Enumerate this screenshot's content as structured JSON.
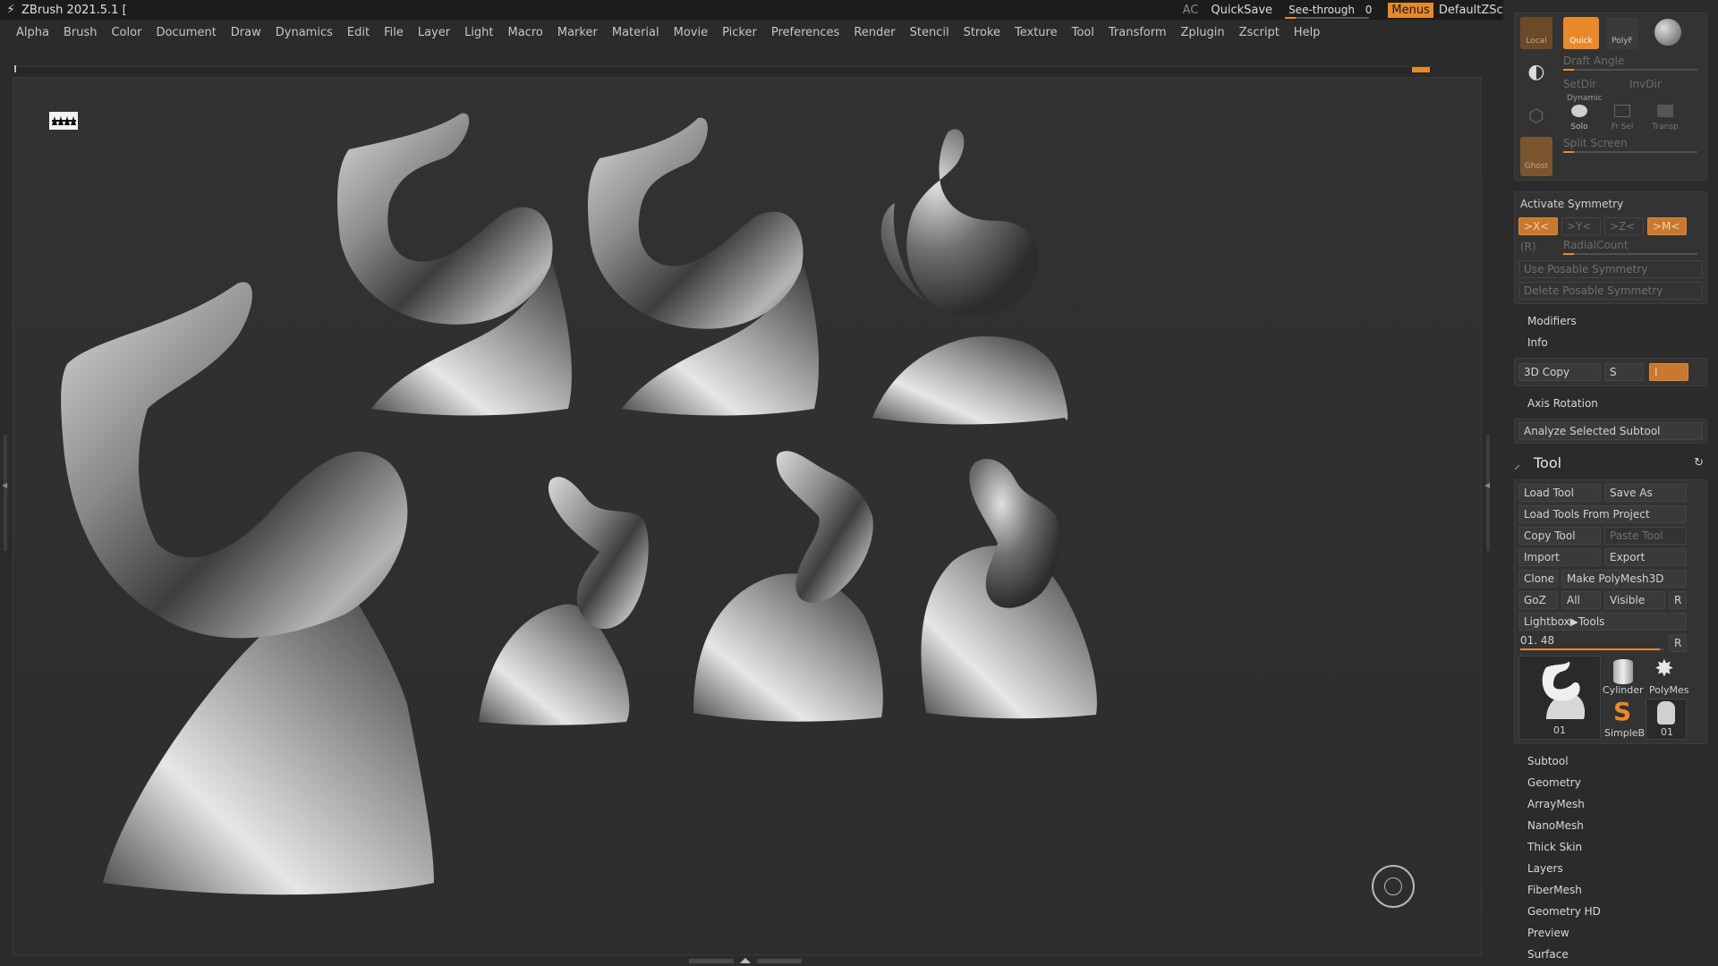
{
  "titlebar": {
    "title": "ZBrush 2021.5.1 [",
    "ac": "AC",
    "quicksave": "QuickSave",
    "see_through_label": "See-through",
    "see_through_value": "0",
    "see_through_level": 0,
    "menus": "Menus",
    "script": "DefaultZScript"
  },
  "menubar": {
    "items": [
      "Alpha",
      "Brush",
      "Color",
      "Document",
      "Draw",
      "Dynamics",
      "Edit",
      "File",
      "Layer",
      "Light",
      "Macro",
      "Marker",
      "Material",
      "Movie",
      "Picker",
      "Preferences",
      "Render",
      "Stencil",
      "Stroke",
      "Texture",
      "Tool",
      "Transform",
      "Zplugin",
      "Zscript",
      "Help"
    ]
  },
  "rpanel": {
    "top": {
      "local": "Local",
      "quick": "Quick",
      "polyf": "PolyF",
      "draft_angle": "Draft Angle",
      "setdir": "SetDir",
      "invdir": "InvDir",
      "dynamic": "Dynamic",
      "solo": "Solo",
      "frsel": "Fr Sel",
      "transp": "Transp",
      "ghost": "Ghost",
      "split_screen": "Split Screen"
    },
    "symmetry": {
      "activate": "Activate Symmetry",
      "x": ">X<",
      "y": ">Y<",
      "z": ">Z<",
      "m": ">M<",
      "r": "(R)",
      "radial": "RadialCount",
      "use_posable": "Use Posable Symmetry",
      "delete_posable": "Delete Posable Symmetry"
    },
    "modifiers": "Modifiers",
    "info": "Info",
    "copy3d": "3D Copy",
    "copy3d_s": "S",
    "copy3d_i": "I",
    "axis_rotation": "Axis Rotation",
    "analyze": "Analyze Selected Subtool",
    "tool": {
      "title": "Tool",
      "load_tool": "Load Tool",
      "save_as": "Save As",
      "load_from_project": "Load Tools From Project",
      "copy_tool": "Copy Tool",
      "paste_tool": "Paste Tool",
      "import": "Import",
      "export": "Export",
      "clone": "Clone",
      "make_polymesh": "Make PolyMesh3D",
      "goz": "GoZ",
      "all": "All",
      "visible": "Visible",
      "r": "R",
      "lightbox": "Lightbox▶Tools",
      "current": "01. 48",
      "current_r": "R",
      "thumb_main": "01",
      "thumb_cylinder": "Cylinder",
      "thumb_polymesh": "PolyMes",
      "thumb_simpleb": "SimpleB",
      "thumb_01": "01"
    },
    "sections": [
      "Subtool",
      "Geometry",
      "ArrayMesh",
      "NanoMesh",
      "Thick Skin",
      "Layers",
      "FiberMesh",
      "Geometry HD",
      "Preview",
      "Surface"
    ]
  },
  "icons": {
    "logo": "zbrush-logo-icon",
    "nav": "navigation-circle-icon",
    "tool": "brush-tool-icon",
    "reset": "refresh-icon"
  },
  "colors": {
    "accent": "#e8892b",
    "background": "#2b2b2b",
    "canvas": "#303030"
  }
}
